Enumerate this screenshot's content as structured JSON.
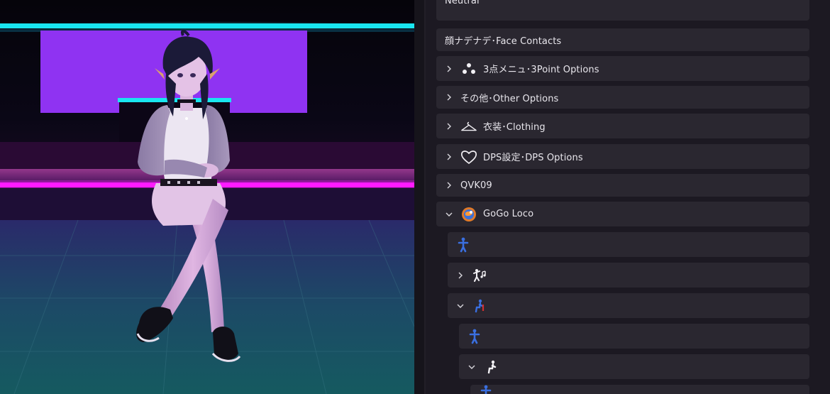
{
  "menu": {
    "items": [
      {
        "label": "Neutral"
      },
      {
        "label": "顔ナデナデ･Face Contacts"
      },
      {
        "label": "3点メニュ･3Point Options",
        "icon": "three-dots-icon"
      },
      {
        "label": "その他･Other Options"
      },
      {
        "label": "衣装･Clothing",
        "icon": "hanger-icon"
      },
      {
        "label": "DPS設定･DPS Options",
        "icon": "heart-icon"
      },
      {
        "label": "QVK09"
      },
      {
        "label": "GoGo Loco",
        "icon": "gogoloco-logo-icon"
      }
    ],
    "sub_icons": [
      "standing-figure-icon",
      "dancing-figure-icon",
      "sitting-figure-icon",
      "standing-figure-icon",
      "sitting-pose-icon",
      "standing-figure-icon"
    ]
  },
  "colors": {
    "panel_bg": "#1c1922",
    "row_bg": "#2a2730",
    "text": "#e8e6ec",
    "neon_cyan": "#19e6f0",
    "neon_magenta": "#ff1aff",
    "neon_purple": "#8a2cf0",
    "figure_blue": "#3a6fe0"
  }
}
